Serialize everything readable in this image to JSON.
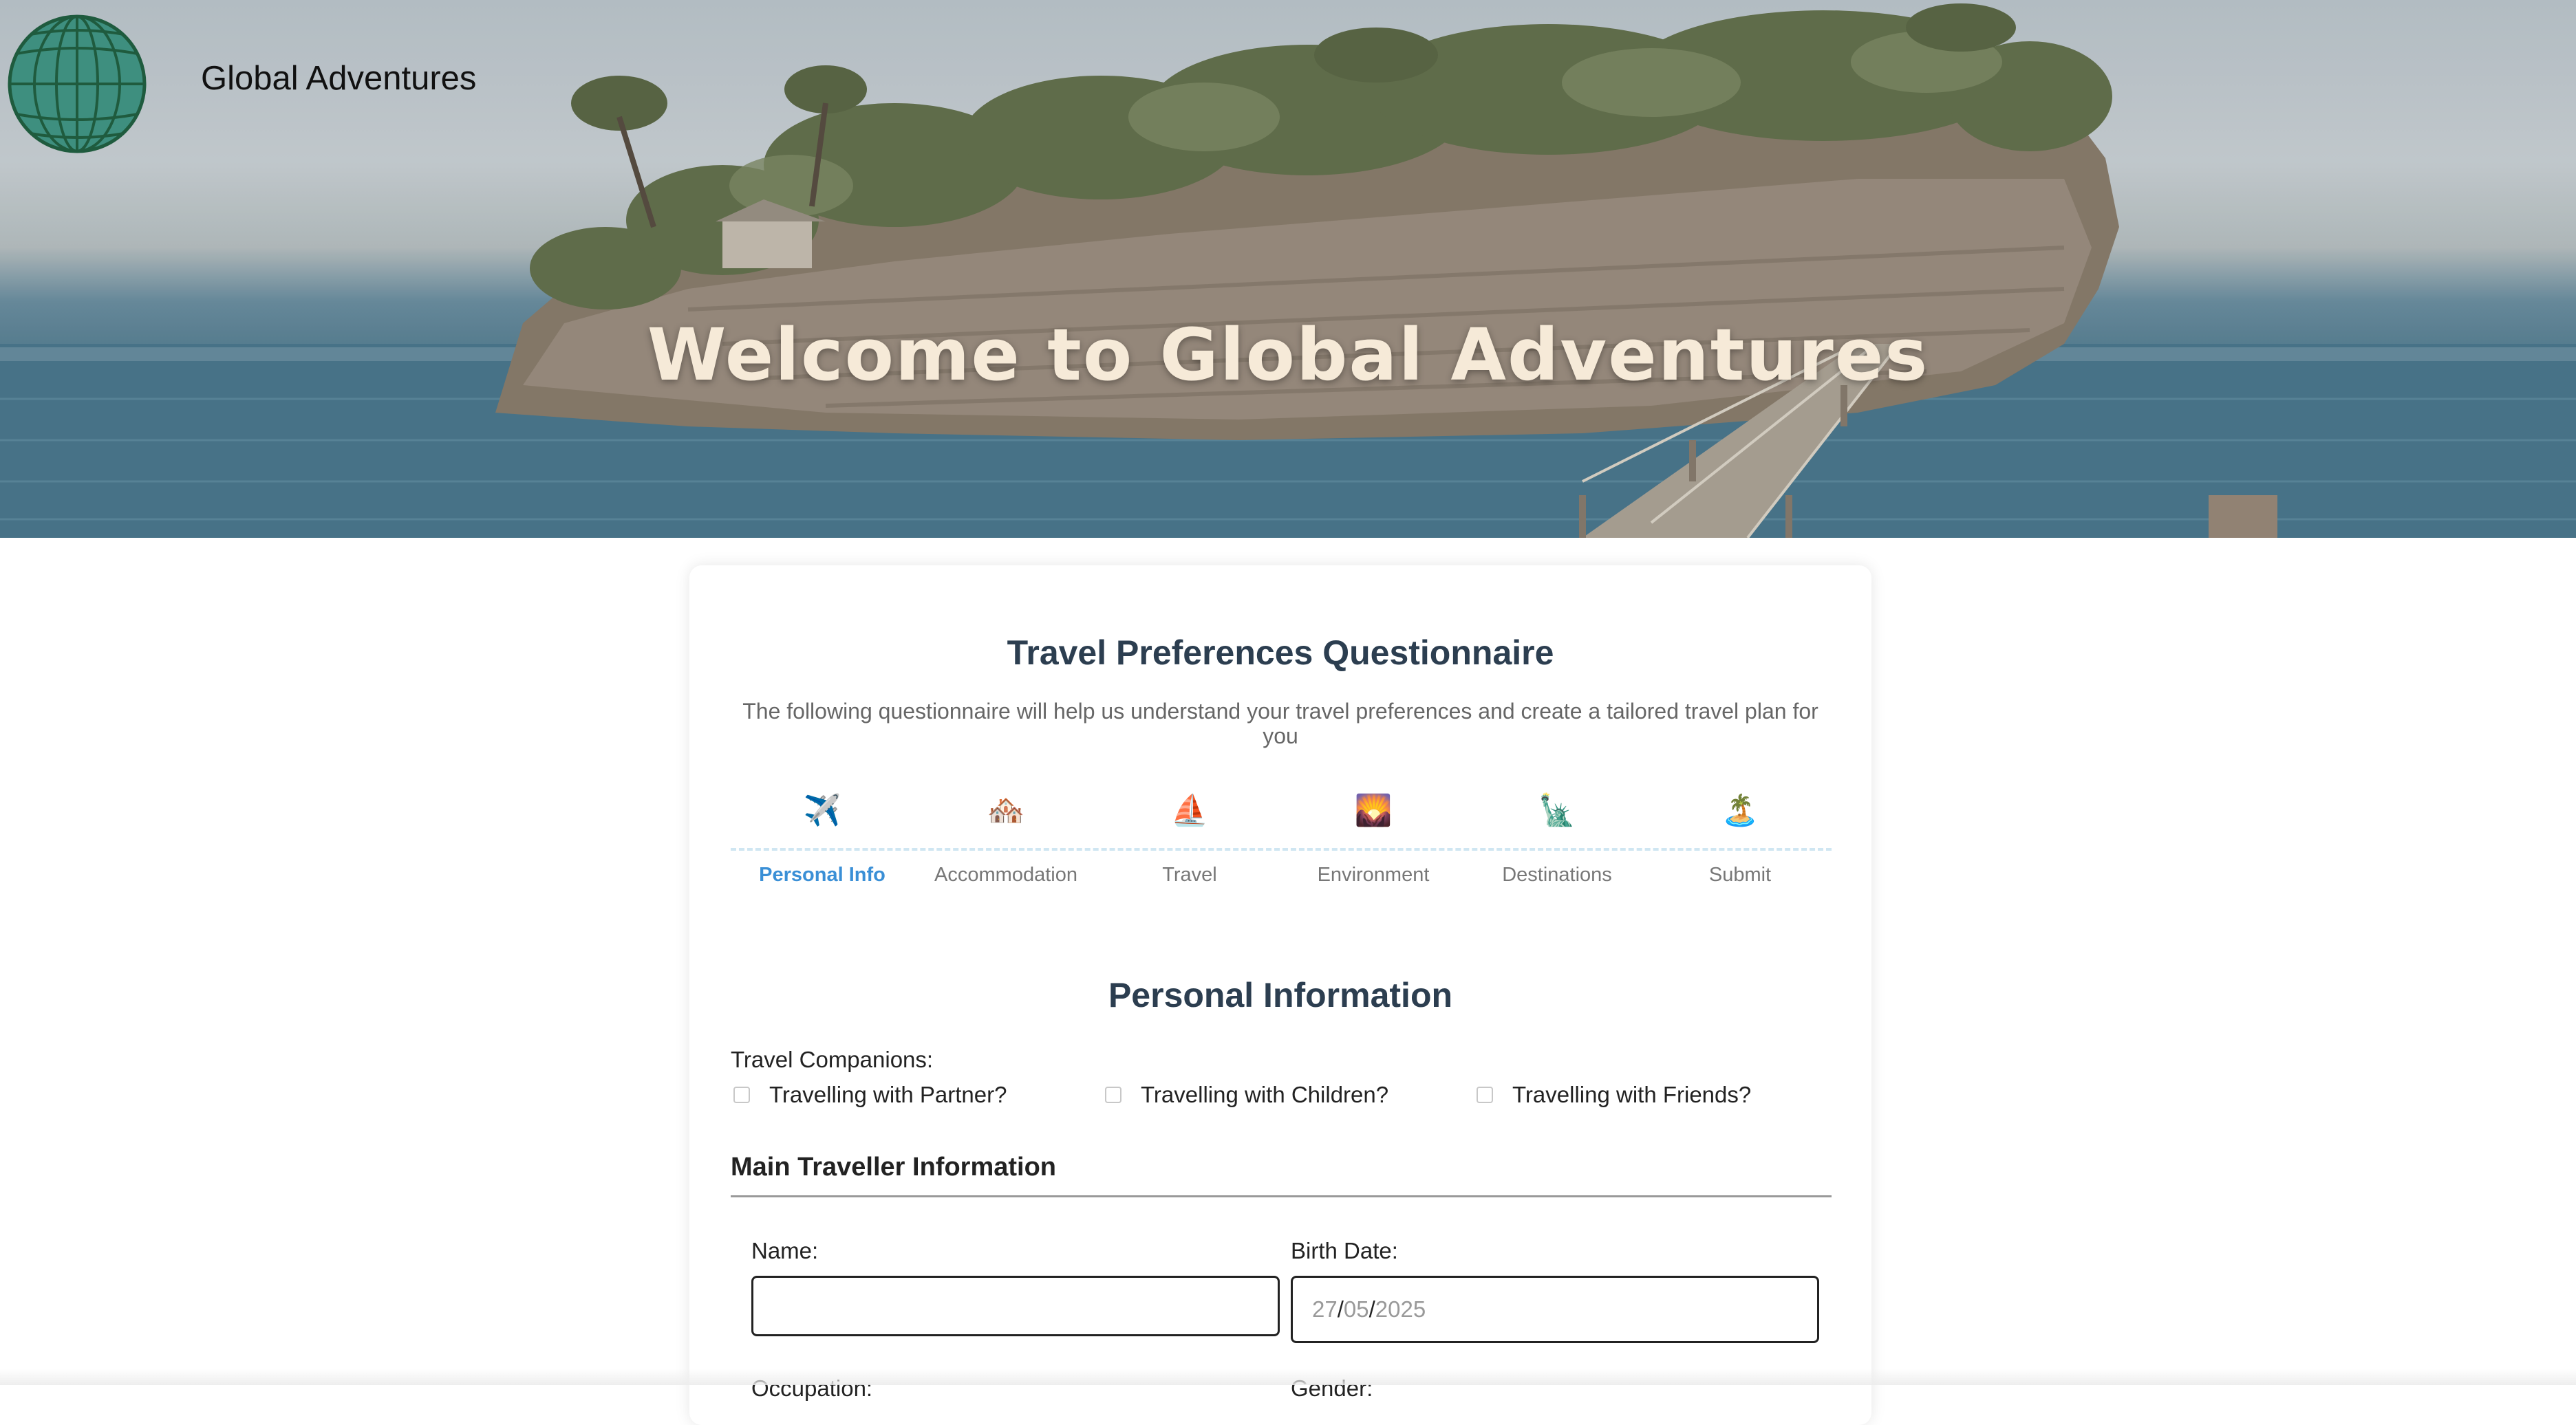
{
  "header": {
    "brand": "Global Adventures",
    "logo_icon": "globe-icon",
    "hero_title": "Welcome to Global Adventures"
  },
  "questionnaire": {
    "title": "Travel Preferences Questionnaire",
    "description": "The following questionnaire will help us understand your travel preferences and create a tailored travel plan for you",
    "steps": [
      {
        "icon": "✈️",
        "icon_name": "airplane-icon",
        "label": "Personal Info",
        "active": true
      },
      {
        "icon": "🏘️",
        "icon_name": "houses-icon",
        "label": "Accommodation",
        "active": false
      },
      {
        "icon": "⛵",
        "icon_name": "sailboat-icon",
        "label": "Travel",
        "active": false
      },
      {
        "icon": "🌄",
        "icon_name": "sunrise-mountains-icon",
        "label": "Environment",
        "active": false
      },
      {
        "icon": "🗽",
        "icon_name": "statue-of-liberty-icon",
        "label": "Destinations",
        "active": false
      },
      {
        "icon": "🏝️",
        "icon_name": "island-icon",
        "label": "Submit",
        "active": false
      }
    ]
  },
  "personal": {
    "section_title": "Personal Information",
    "companions_label": "Travel Companions:",
    "companions": [
      {
        "label": "Travelling with Partner?",
        "checked": false
      },
      {
        "label": "Travelling with Children?",
        "checked": false
      },
      {
        "label": "Travelling with Friends?",
        "checked": false
      }
    ],
    "main_traveller_heading": "Main Traveller Information",
    "name_label": "Name:",
    "name_value": "",
    "birth_label": "Birth Date:",
    "birth_day": "27",
    "birth_month": "05",
    "birth_year": "2025",
    "occupation_label": "Occupation:",
    "gender_label": "Gender:"
  },
  "colors": {
    "accent": "#3a8fd6",
    "heading": "#2c3e50",
    "hero_text": "#f6ead8"
  }
}
